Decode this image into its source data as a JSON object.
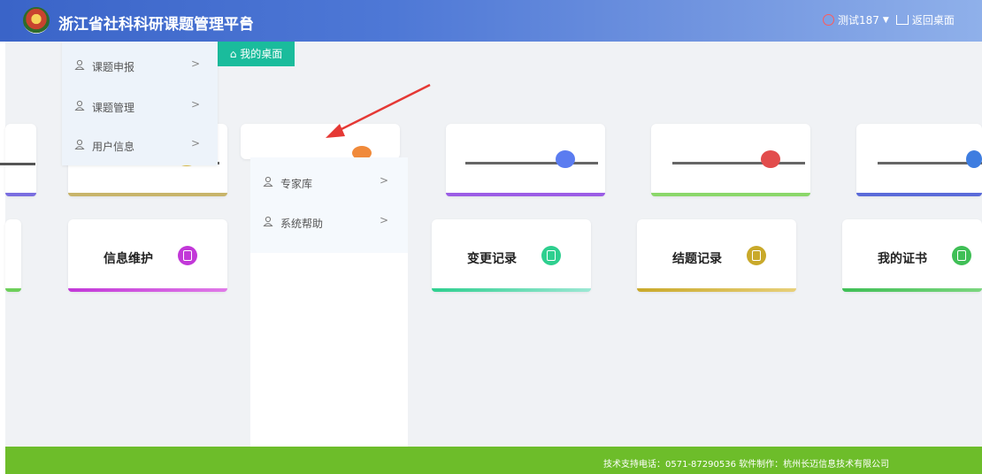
{
  "header": {
    "title": "浙江省社科科研课题管理平台",
    "menu_icon": "hamburger-icon",
    "user_name": "测试187",
    "dropdown_caret": "▼",
    "back_to_desktop": "返回桌面"
  },
  "tabs": {
    "active_label": "我的桌面"
  },
  "menu": {
    "items": [
      {
        "label": "课题申报",
        "arrow": ">"
      },
      {
        "label": "课题管理",
        "arrow": ">"
      },
      {
        "label": "用户信息",
        "arrow": ">"
      }
    ],
    "items2": [
      {
        "label": "专家库",
        "arrow": ">"
      },
      {
        "label": "系统帮助",
        "arrow": ">"
      }
    ]
  },
  "cards": {
    "row2": [
      {
        "label": "信息维护",
        "color": "#c238d8"
      },
      {
        "label": "变更记录",
        "color": "#2ecf8f"
      },
      {
        "label": "结题记录",
        "color": "#c9a92a"
      },
      {
        "label": "我的证书",
        "color": "#3fbf56"
      }
    ]
  },
  "colors": {
    "header": "#4e78d6",
    "tab_active": "#1abc9c",
    "footer": "#6dbd2a"
  },
  "footer": {
    "text": "技术支持电话：0571-87290536 软件制作：杭州长迈信息技术有限公司"
  }
}
